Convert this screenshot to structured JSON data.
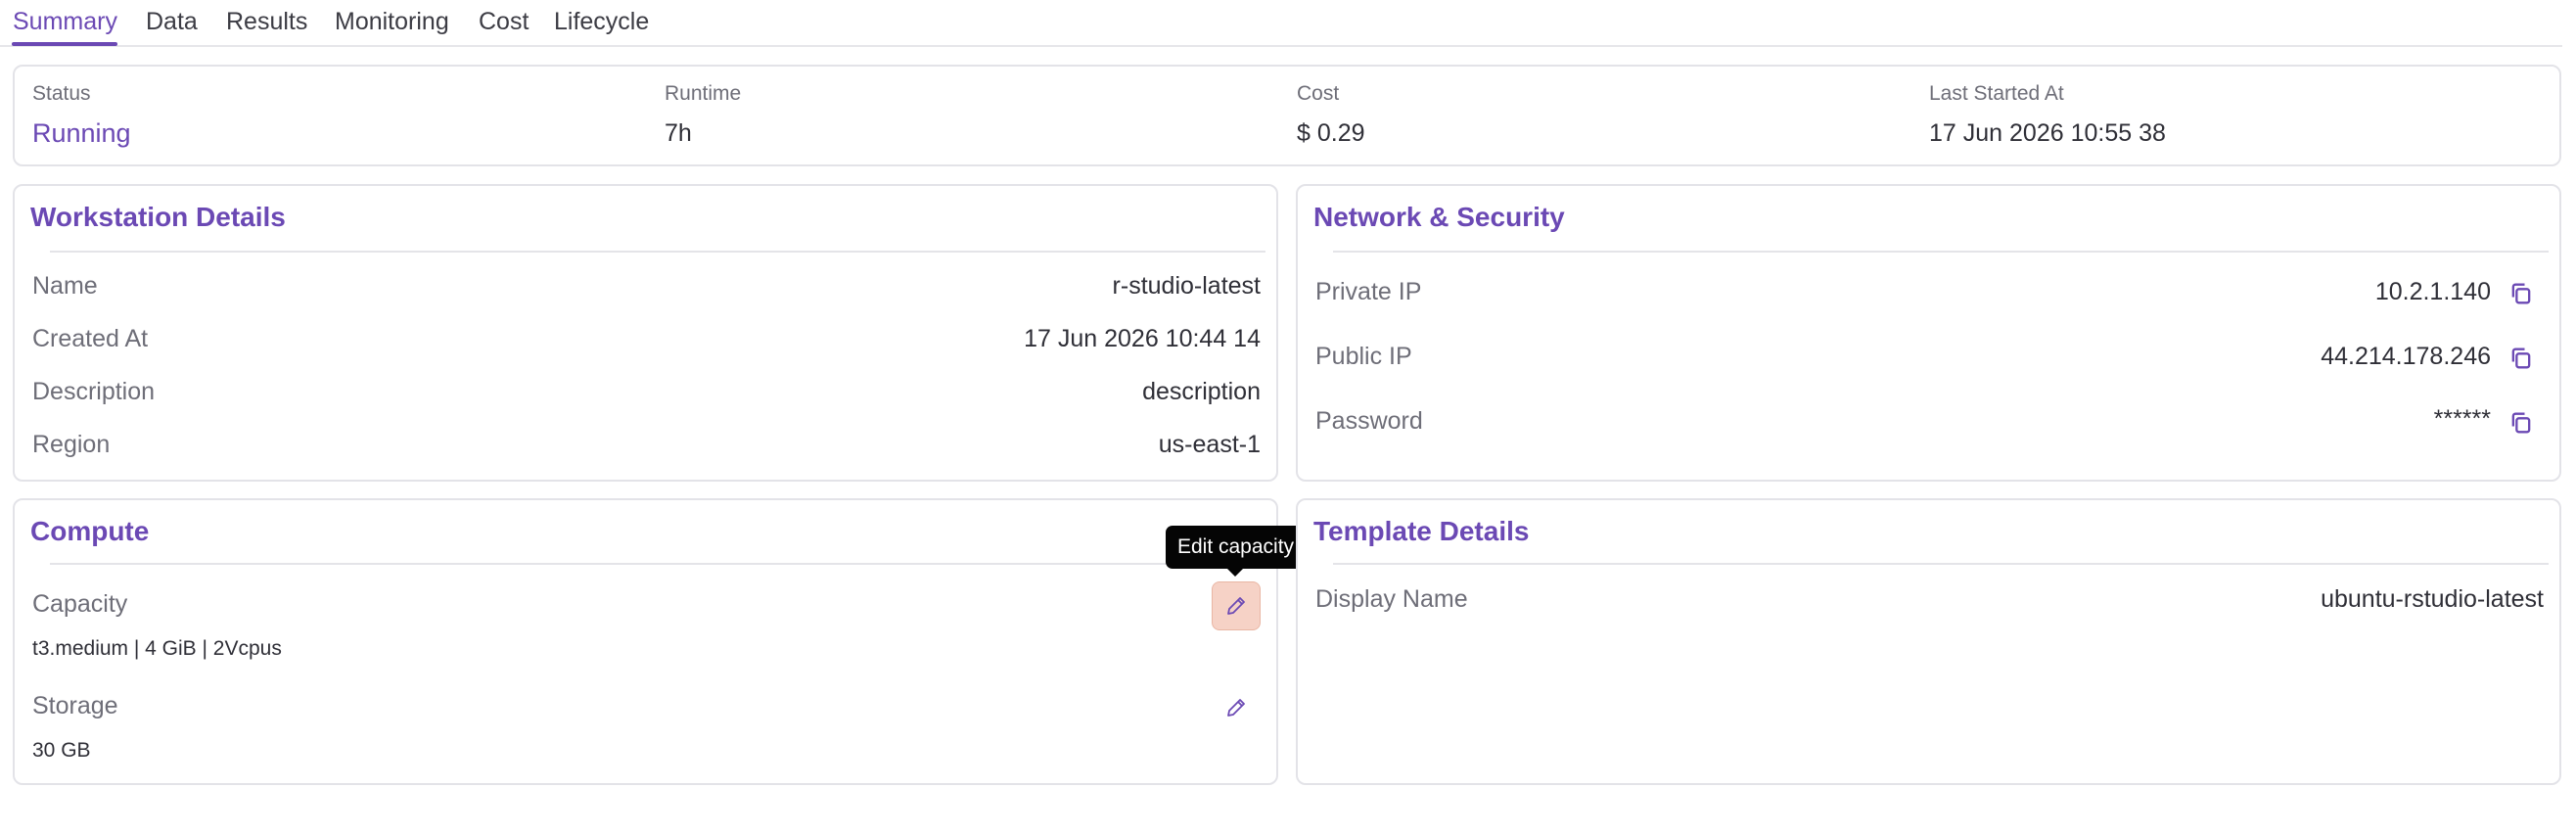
{
  "tabs": [
    {
      "label": "Summary",
      "active": true
    },
    {
      "label": "Data"
    },
    {
      "label": "Results"
    },
    {
      "label": "Monitoring"
    },
    {
      "label": "Cost"
    },
    {
      "label": "Lifecycle"
    }
  ],
  "summary": {
    "status_label": "Status",
    "status_value": "Running",
    "runtime_label": "Runtime",
    "runtime_value": "7h",
    "cost_label": "Cost",
    "cost_value": "$ 0.29",
    "last_started_label": "Last Started At",
    "last_started_value": "17 Jun 2026 10:55 38"
  },
  "workstation": {
    "title": "Workstation Details",
    "rows": [
      {
        "label": "Name",
        "value": "r-studio-latest"
      },
      {
        "label": "Created At",
        "value": "17 Jun 2026 10:44 14"
      },
      {
        "label": "Description",
        "value": "description"
      },
      {
        "label": "Region",
        "value": "us-east-1"
      }
    ]
  },
  "network": {
    "title": "Network & Security",
    "rows": [
      {
        "label": "Private IP",
        "value": "10.2.1.140",
        "icon": "copy-icon"
      },
      {
        "label": "Public IP",
        "value": "44.214.178.246",
        "icon": "copy-icon"
      },
      {
        "label": "Password",
        "value": "******",
        "icon": "copy-icon"
      }
    ]
  },
  "compute": {
    "title": "Compute",
    "capacity_label": "Capacity",
    "capacity_value": "t3.medium | 4 GiB | 2Vcpus",
    "storage_label": "Storage",
    "storage_value": "30 GB",
    "edit_icon": "pencil-icon",
    "tooltip": "Edit capacity"
  },
  "template": {
    "title": "Template Details",
    "display_name_label": "Display Name",
    "display_name_value": "ubuntu-rstudio-latest"
  },
  "colors": {
    "accent": "#6b49b4",
    "border": "#e3e3e8",
    "edit_hover_bg": "#f6d2c6",
    "tooltip_bg": "#050505"
  }
}
